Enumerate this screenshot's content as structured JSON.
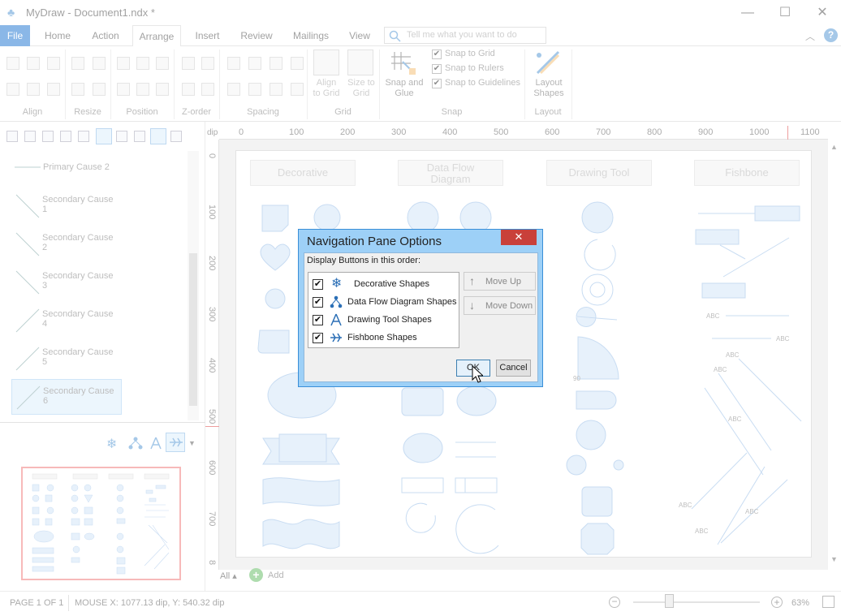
{
  "window": {
    "title": "MyDraw - Document1.ndx *",
    "minimize": "—",
    "maximize": "☐",
    "close": "✕"
  },
  "ribbon_tabs": [
    "File",
    "Home",
    "Action",
    "Arrange",
    "Insert",
    "Review",
    "Mailings",
    "View"
  ],
  "active_tab": "Arrange",
  "tell_me": {
    "placeholder": "Tell me what you want to do"
  },
  "ribbon": {
    "groups": [
      "Align",
      "Resize",
      "Position",
      "Z-order",
      "Spacing",
      "Grid",
      "Snap",
      "Layout"
    ],
    "align_to_grid": "Align\nto Grid",
    "size_to_grid": "Size to\nGrid",
    "snap_and_glue": "Snap and\nGlue",
    "snap_to_grid": "Snap to Grid",
    "snap_to_rulers": "Snap to Rulers",
    "snap_to_guidelines": "Snap to Guidelines",
    "layout_shapes": "Layout\nShapes"
  },
  "shape_list": [
    {
      "label": "Primary Cause 2"
    },
    {
      "label": "Secondary Cause\n1"
    },
    {
      "label": "Secondary Cause\n2"
    },
    {
      "label": "Secondary Cause\n3"
    },
    {
      "label": "Secondary Cause\n4"
    },
    {
      "label": "Secondary Cause\n5"
    },
    {
      "label": "Secondary Cause\n6",
      "selected": true
    }
  ],
  "ruler": {
    "unit": "dip",
    "h_ticks": [
      "0",
      "100",
      "200",
      "300",
      "400",
      "500",
      "600",
      "700",
      "800",
      "900",
      "1000",
      "1100"
    ],
    "v_ticks": [
      "0",
      "100",
      "200",
      "300",
      "400",
      "500",
      "600",
      "700",
      "8"
    ]
  },
  "canvas_headers": [
    "Decorative",
    "Data Flow\nDiagram",
    "Drawing Tool",
    "Fishbone"
  ],
  "canvas_labels": {
    "abc": "ABC",
    "angle": "90"
  },
  "bottom": {
    "all_tab": "All ▴",
    "add": "Add"
  },
  "status": {
    "page": "PAGE 1 OF 1",
    "mouse": "MOUSE X: 1077.13 dip, Y: 540.32 dip",
    "zoom": "63%"
  },
  "dialog": {
    "title": "Navigation Pane Options",
    "close": "✕",
    "instruction": "Display Buttons in this order:",
    "items": [
      {
        "label": "Decorative Shapes",
        "checked": "✔",
        "icon": "snowflake-icon"
      },
      {
        "label": "Data Flow Diagram Shapes",
        "checked": "✔",
        "icon": "dataflow-icon"
      },
      {
        "label": "Drawing Tool Shapes",
        "checked": "✔",
        "icon": "compass-icon"
      },
      {
        "label": "Fishbone Shapes",
        "checked": "✔",
        "icon": "fishbone-icon"
      }
    ],
    "move_up": "Move Up",
    "move_down": "Move Down",
    "ok": "OK",
    "cancel": "Cancel"
  },
  "colors": {
    "accent": "#2b7dd3",
    "dialog_title_bg": "#9dd0f7",
    "shape_fill": "#d3e5f8",
    "shape_stroke": "#9cc0e8"
  }
}
